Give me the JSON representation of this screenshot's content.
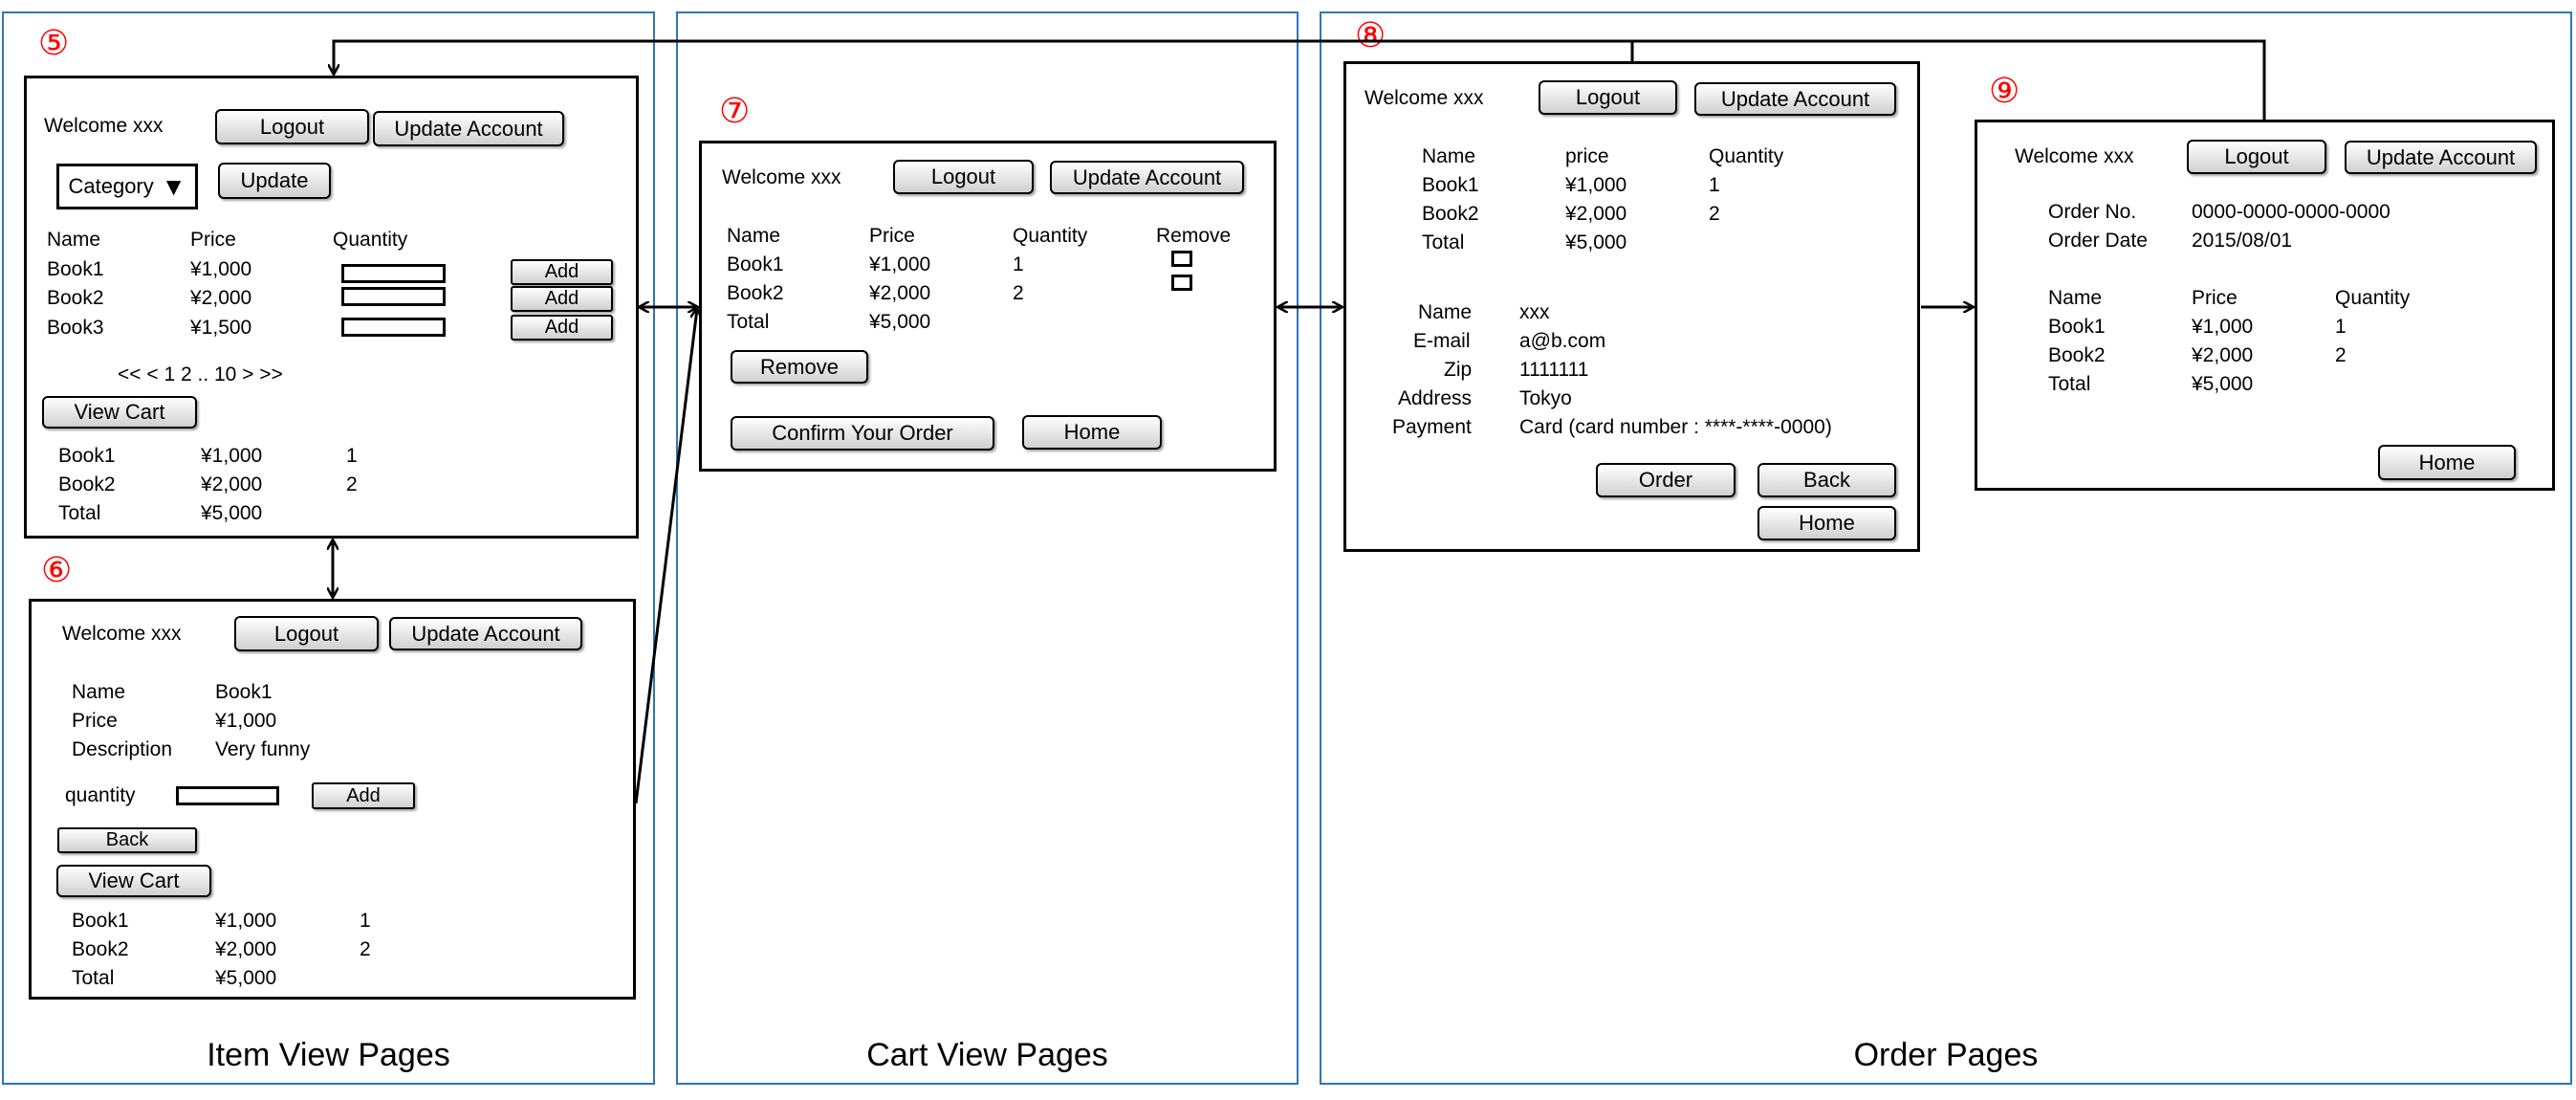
{
  "sections": {
    "item": "Item View Pages",
    "cart": "Cart View Pages",
    "order": "Order Pages"
  },
  "markers": {
    "p5": "⑤",
    "p6": "⑥",
    "p7": "⑦",
    "p8": "⑧",
    "p9": "⑨"
  },
  "common": {
    "welcome": "Welcome  xxx",
    "logout": "Logout",
    "update_account": "Update Account",
    "add": "Add",
    "view_cart": "View Cart",
    "home": "Home",
    "back": "Back",
    "name": "Name",
    "price": "Price",
    "quantity": "Quantity",
    "book1": "Book1",
    "book2": "Book2",
    "book3": "Book3",
    "total": "Total",
    "p1000": "¥1,000",
    "p2000": "¥2,000",
    "p1500": "¥1,500",
    "p5000": "¥5,000",
    "q1": "1",
    "q2": "2"
  },
  "page5": {
    "category": "Category",
    "category_arrow": "▼",
    "update": "Update",
    "pager": "<< < 1 2 .. 10 > >>"
  },
  "page6": {
    "welcome": "Welcome xxx",
    "description_label": "Description",
    "description_value": "Very funny",
    "quantity_label": "quantity"
  },
  "page7": {
    "remove_col": "Remove",
    "remove_button": "Remove",
    "confirm": "Confirm Your Order"
  },
  "page8": {
    "price_col": "price",
    "email_label": "E-mail",
    "zip_label": "Zip",
    "address_label": "Address",
    "payment_label": "Payment",
    "name_value": "xxx",
    "email_value": "a@b.com",
    "zip_value": "1111111",
    "address_value": "Tokyo",
    "payment_value": "Card (card number :  ****-****-0000)",
    "order_button": "Order"
  },
  "page9": {
    "order_no_label": "Order No.",
    "order_no_value": "0000-0000-0000-0000",
    "order_date_label": "Order Date",
    "order_date_value": "2015/08/01"
  }
}
